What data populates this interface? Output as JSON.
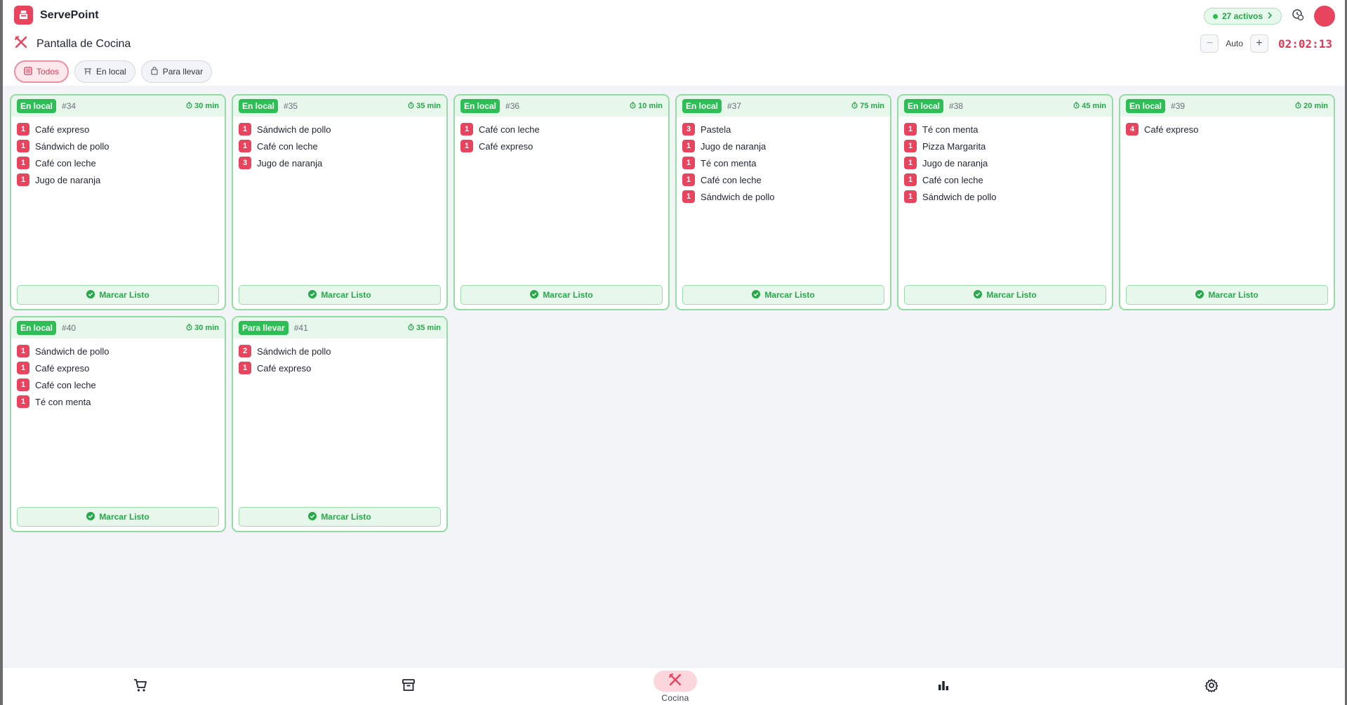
{
  "app": {
    "name": "ServePoint",
    "active_count_label": "27 activos",
    "accent_color": "#e8445e",
    "success_color": "#2dbf55"
  },
  "page": {
    "title": "Pantalla de Cocina",
    "icon": "utensils-crossed-icon"
  },
  "controls": {
    "minus_label": "−",
    "auto_label": "Auto",
    "plus_label": "+",
    "clock": "02:02:13"
  },
  "filters": [
    {
      "label": "Todos",
      "icon": "list-icon",
      "active": true
    },
    {
      "label": "En local",
      "icon": "table-icon",
      "active": false
    },
    {
      "label": "Para llevar",
      "icon": "bag-icon",
      "active": false
    }
  ],
  "ready_label": "Marcar Listo",
  "orders": [
    {
      "type": "En local",
      "number": "#34",
      "time": "30 min",
      "items": [
        {
          "qty": "1",
          "name": "Café expreso"
        },
        {
          "qty": "1",
          "name": "Sándwich de pollo"
        },
        {
          "qty": "1",
          "name": "Café con leche"
        },
        {
          "qty": "1",
          "name": "Jugo de naranja"
        }
      ]
    },
    {
      "type": "En local",
      "number": "#35",
      "time": "35 min",
      "items": [
        {
          "qty": "1",
          "name": "Sándwich de pollo"
        },
        {
          "qty": "1",
          "name": "Café con leche"
        },
        {
          "qty": "3",
          "name": "Jugo de naranja"
        }
      ]
    },
    {
      "type": "En local",
      "number": "#36",
      "time": "10 min",
      "items": [
        {
          "qty": "1",
          "name": "Café con leche"
        },
        {
          "qty": "1",
          "name": "Café expreso"
        }
      ]
    },
    {
      "type": "En local",
      "number": "#37",
      "time": "75 min",
      "items": [
        {
          "qty": "3",
          "name": "Pastela"
        },
        {
          "qty": "1",
          "name": "Jugo de naranja"
        },
        {
          "qty": "1",
          "name": "Té con menta"
        },
        {
          "qty": "1",
          "name": "Café con leche"
        },
        {
          "qty": "1",
          "name": "Sándwich de pollo"
        }
      ]
    },
    {
      "type": "En local",
      "number": "#38",
      "time": "45 min",
      "items": [
        {
          "qty": "1",
          "name": "Té con menta"
        },
        {
          "qty": "1",
          "name": "Pizza Margarita"
        },
        {
          "qty": "1",
          "name": "Jugo de naranja"
        },
        {
          "qty": "1",
          "name": "Café con leche"
        },
        {
          "qty": "1",
          "name": "Sándwich de pollo"
        }
      ]
    },
    {
      "type": "En local",
      "number": "#39",
      "time": "20 min",
      "items": [
        {
          "qty": "4",
          "name": "Café expreso"
        }
      ]
    },
    {
      "type": "En local",
      "number": "#40",
      "time": "30 min",
      "items": [
        {
          "qty": "1",
          "name": "Sándwich de pollo"
        },
        {
          "qty": "1",
          "name": "Café expreso"
        },
        {
          "qty": "1",
          "name": "Café con leche"
        },
        {
          "qty": "1",
          "name": "Té con menta"
        }
      ]
    },
    {
      "type": "Para llevar",
      "number": "#41",
      "time": "35 min",
      "items": [
        {
          "qty": "2",
          "name": "Sándwich de pollo"
        },
        {
          "qty": "1",
          "name": "Café expreso"
        }
      ]
    }
  ],
  "bottom_nav": [
    {
      "icon": "cart-icon",
      "label": "",
      "active": false
    },
    {
      "icon": "archive-icon",
      "label": "",
      "active": false
    },
    {
      "icon": "utensils-crossed-icon",
      "label": "Cocina",
      "active": true
    },
    {
      "icon": "bar-chart-icon",
      "label": "",
      "active": false
    },
    {
      "icon": "gear-icon",
      "label": "",
      "active": false
    }
  ]
}
